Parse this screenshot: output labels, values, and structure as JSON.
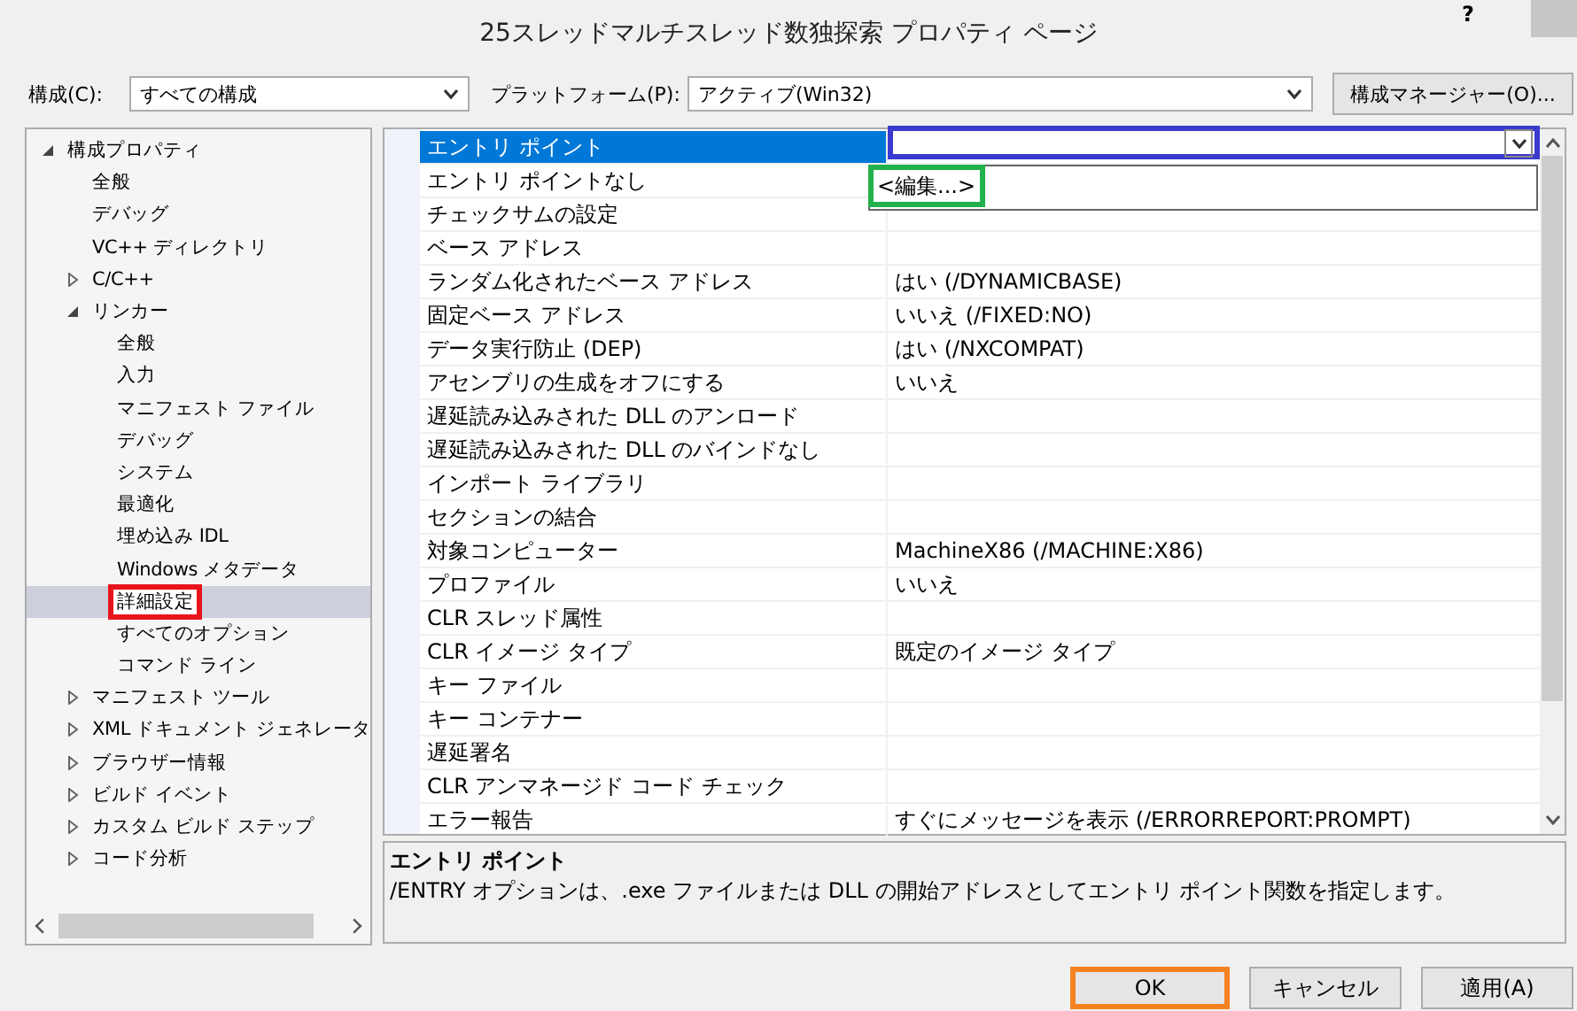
{
  "window": {
    "title": "25スレッドマルチスレッド数独探索 プロパティ ページ",
    "help": "?"
  },
  "toolbar": {
    "config_label": "構成(C):",
    "config_value": "すべての構成",
    "platform_label": "プラットフォーム(P):",
    "platform_value": "アクティブ(Win32)",
    "manager_button": "構成マネージャー(O)..."
  },
  "tree": [
    {
      "label": "構成プロパティ",
      "expanded": true,
      "selected": false,
      "children": [
        {
          "label": "全般",
          "selected": false
        },
        {
          "label": "デバッグ",
          "selected": false
        },
        {
          "label": "VC++ ディレクトリ",
          "selected": false
        },
        {
          "label": "C/C++",
          "expanded": false,
          "selected": false
        },
        {
          "label": "リンカー",
          "expanded": true,
          "selected": false,
          "children": [
            {
              "label": "全般",
              "selected": false
            },
            {
              "label": "入力",
              "selected": false
            },
            {
              "label": "マニフェスト ファイル",
              "selected": false
            },
            {
              "label": "デバッグ",
              "selected": false
            },
            {
              "label": "システム",
              "selected": false
            },
            {
              "label": "最適化",
              "selected": false
            },
            {
              "label": "埋め込み IDL",
              "selected": false
            },
            {
              "label": "Windows メタデータ",
              "selected": false
            },
            {
              "label": "詳細設定",
              "selected": true,
              "color": "#e8141c"
            },
            {
              "label": "すべてのオプション",
              "selected": false
            },
            {
              "label": "コマンド ライン",
              "selected": false
            }
          ]
        },
        {
          "label": "マニフェスト ツール",
          "expanded": false,
          "selected": false
        },
        {
          "label": "XML ドキュメント ジェネレータ",
          "expanded": false,
          "selected": false
        },
        {
          "label": "ブラウザー情報",
          "expanded": false,
          "selected": false
        },
        {
          "label": "ビルド イベント",
          "expanded": false,
          "selected": false
        },
        {
          "label": "カスタム ビルド ステップ",
          "expanded": false,
          "selected": false
        },
        {
          "label": "コード分析",
          "expanded": false,
          "selected": false
        }
      ]
    }
  ],
  "grid": {
    "rows": [
      {
        "name": "エントリ ポイント",
        "kind": "dropdown",
        "selected": true,
        "expanded": true,
        "color": "#3a3acf",
        "options": [
          {
            "label": "<編集...>",
            "color": "#22b14c"
          }
        ]
      },
      {
        "name": "エントリ ポイントなし",
        "kind": "text",
        "selected": false
      },
      {
        "name": "チェックサムの設定",
        "kind": "text",
        "selected": false
      },
      {
        "name": "ベース アドレス",
        "kind": "text",
        "selected": false
      },
      {
        "name": "ランダム化されたベース アドレス",
        "kind": "text",
        "selected": false,
        "value": "はい (/DYNAMICBASE)"
      },
      {
        "name": "固定ベース アドレス",
        "kind": "text",
        "selected": false,
        "value": "いいえ (/FIXED:NO)"
      },
      {
        "name": "データ実行防止 (DEP)",
        "kind": "text",
        "selected": false,
        "value": "はい (/NXCOMPAT)"
      },
      {
        "name": "アセンブリの生成をオフにする",
        "kind": "text",
        "selected": false,
        "value": "いいえ"
      },
      {
        "name": "遅延読み込みされた DLL のアンロード",
        "kind": "text",
        "selected": false
      },
      {
        "name": "遅延読み込みされた DLL のバインドなし",
        "kind": "text",
        "selected": false
      },
      {
        "name": "インポート ライブラリ",
        "kind": "text",
        "selected": false
      },
      {
        "name": "セクションの結合",
        "kind": "text",
        "selected": false
      },
      {
        "name": "対象コンピューター",
        "kind": "text",
        "selected": false,
        "value": "MachineX86 (/MACHINE:X86)"
      },
      {
        "name": "プロファイル",
        "kind": "text",
        "selected": false,
        "value": "いいえ"
      },
      {
        "name": "CLR スレッド属性",
        "kind": "text",
        "selected": false
      },
      {
        "name": "CLR イメージ タイプ",
        "kind": "text",
        "selected": false,
        "value": "既定のイメージ タイプ"
      },
      {
        "name": "キー ファイル",
        "kind": "text",
        "selected": false
      },
      {
        "name": "キー コンテナー",
        "kind": "text",
        "selected": false
      },
      {
        "name": "遅延署名",
        "kind": "text",
        "selected": false
      },
      {
        "name": "CLR アンマネージド コード チェック",
        "kind": "text",
        "selected": false
      },
      {
        "name": "エラー報告",
        "kind": "text",
        "selected": false,
        "value": "すぐにメッセージを表示 (/ERRORREPORT:PROMPT)"
      }
    ]
  },
  "description": {
    "title": "エントリ ポイント",
    "text": "/ENTRY オプションは、.exe ファイルまたは DLL の開始アドレスとしてエントリ ポイント関数を指定します。"
  },
  "buttons": [
    {
      "label": "OK",
      "color": "#f58220"
    },
    {
      "label": "キャンセル"
    },
    {
      "label": "適用(A)"
    }
  ]
}
